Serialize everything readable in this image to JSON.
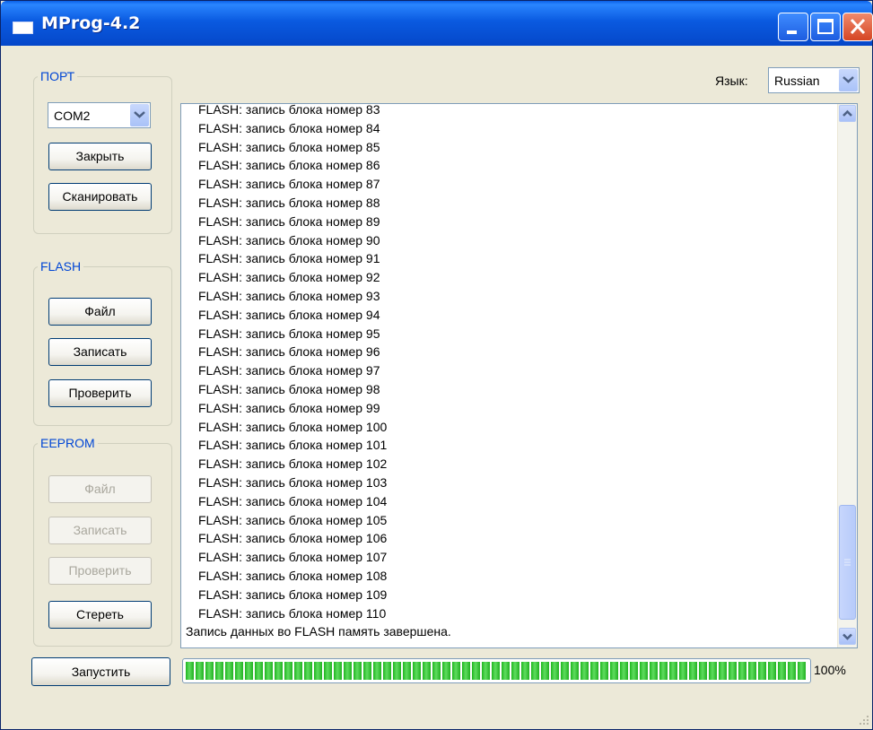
{
  "window": {
    "title": "MProg-4.2"
  },
  "port_group": {
    "label": "ПОРТ",
    "combo_value": "COM2",
    "close_label": "Закрыть",
    "scan_label": "Сканировать"
  },
  "flash_group": {
    "label": "FLASH",
    "file_label": "Файл",
    "write_label": "Записать",
    "verify_label": "Проверить"
  },
  "eeprom_group": {
    "label": "EEPROM",
    "file_label": "Файл",
    "write_label": "Записать",
    "verify_label": "Проверить",
    "erase_label": "Стереть"
  },
  "language": {
    "label": "Язык:",
    "value": "Russian"
  },
  "log": {
    "lines": [
      "FLASH: запись блока номер 83",
      "FLASH: запись блока номер 84",
      "FLASH: запись блока номер 85",
      "FLASH: запись блока номер 86",
      "FLASH: запись блока номер 87",
      "FLASH: запись блока номер 88",
      "FLASH: запись блока номер 89",
      "FLASH: запись блока номер 90",
      "FLASH: запись блока номер 91",
      "FLASH: запись блока номер 92",
      "FLASH: запись блока номер 93",
      "FLASH: запись блока номер 94",
      "FLASH: запись блока номер 95",
      "FLASH: запись блока номер 96",
      "FLASH: запись блока номер 97",
      "FLASH: запись блока номер 98",
      "FLASH: запись блока номер 99",
      "FLASH: запись блока номер 100",
      "FLASH: запись блока номер 101",
      "FLASH: запись блока номер 102",
      "FLASH: запись блока номер 103",
      "FLASH: запись блока номер 104",
      "FLASH: запись блока номер 105",
      "FLASH: запись блока номер 106",
      "FLASH: запись блока номер 107",
      "FLASH: запись блока номер 108",
      "FLASH: запись блока номер 109",
      "FLASH: запись блока номер 110"
    ],
    "final_line": "Запись данных во FLASH память завершена."
  },
  "run_button": {
    "label": "Запустить"
  },
  "progress": {
    "value": 1.0,
    "text": "100%"
  },
  "colors": {
    "titlebar": "#0a5ae0",
    "progress": "#1fb51f",
    "group_label": "#0046d5"
  }
}
